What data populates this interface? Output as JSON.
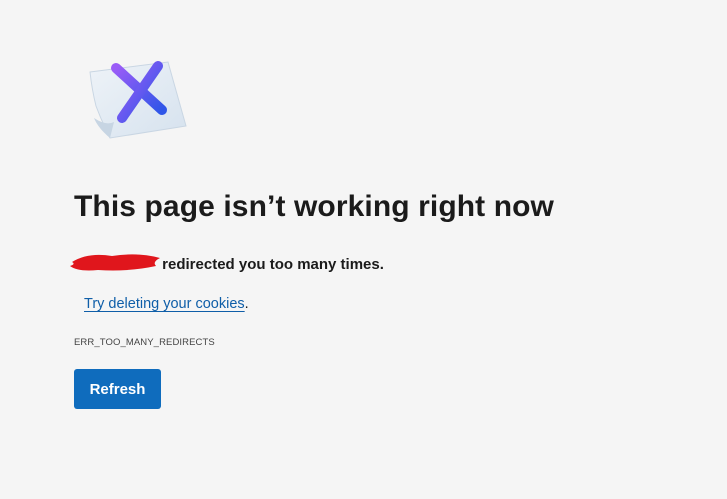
{
  "illustration": {
    "icon": "error-x-note-icon",
    "colors": {
      "paper": "#dfe8f1",
      "x_start": "#8a5cf6",
      "x_end": "#2f5bea"
    }
  },
  "title": "This page isn’t working right now",
  "message": {
    "redacted_host_color": "#e0161c",
    "text": "redirected you too many times."
  },
  "suggestion": {
    "link_text": "Try deleting your cookies",
    "suffix": "."
  },
  "error_code": "ERR_TOO_MANY_REDIRECTS",
  "refresh_button": {
    "label": "Refresh",
    "color": "#0f6cbd"
  }
}
